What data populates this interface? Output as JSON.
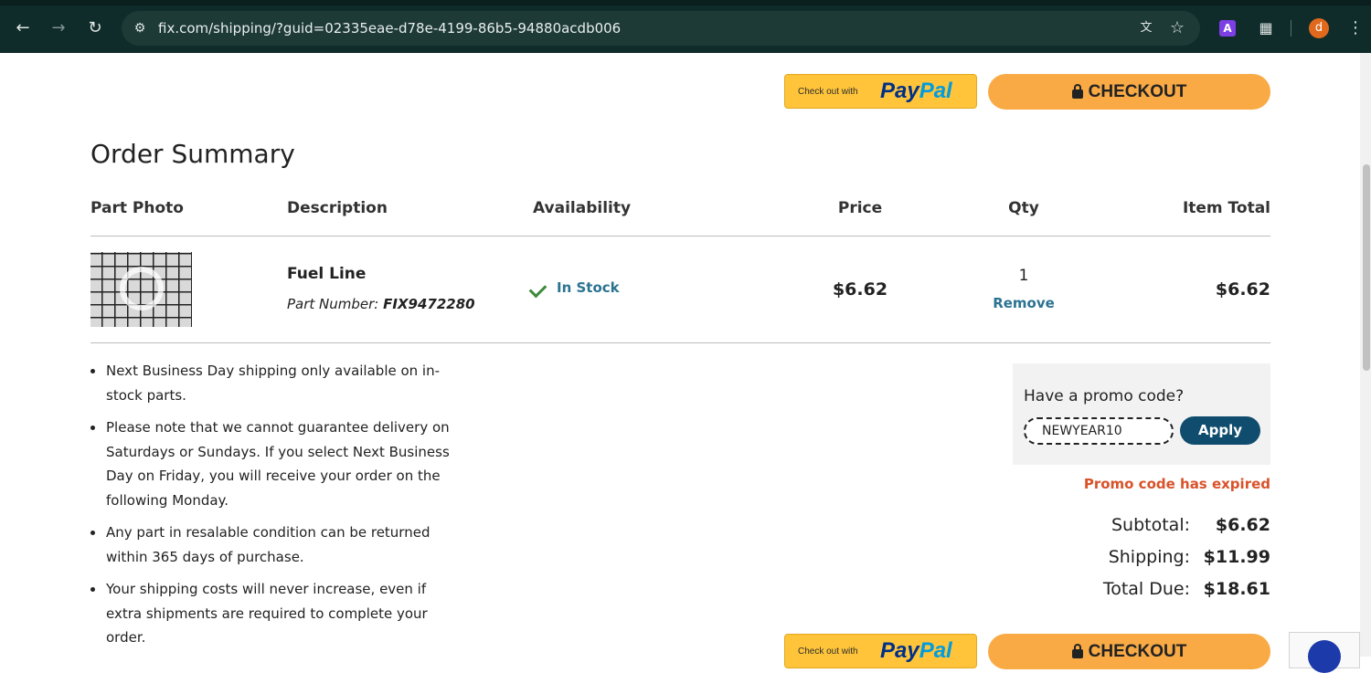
{
  "browser": {
    "url": "fix.com/shipping/?guid=02335eae-d78e-4199-86b5-94880acdb006",
    "extension_letter": "A",
    "avatar_letter": "d"
  },
  "actions": {
    "paypal_small": "Check out with",
    "paypal_pay": "Pay",
    "paypal_pal": "Pal",
    "checkout_label": "CHECKOUT"
  },
  "summary": {
    "title": "Order Summary",
    "headers": {
      "photo": "Part Photo",
      "description": "Description",
      "availability": "Availability",
      "price": "Price",
      "qty": "Qty",
      "item_total": "Item Total"
    },
    "item": {
      "name": "Fuel Line",
      "part_number_label": "Part Number:",
      "part_number": "FIX9472280",
      "availability": "In Stock",
      "price": "$6.62",
      "qty": "1",
      "remove_label": "Remove",
      "item_total": "$6.62"
    }
  },
  "notes": [
    "Next Business Day shipping only available on in-stock parts.",
    "Please note that we cannot guarantee delivery on Saturdays or Sundays. If you select Next Business Day on Friday, you will receive your order on the following Monday.",
    "Any part in resalable condition can be returned within 365 days of purchase.",
    "Your shipping costs will never increase, even if extra shipments are required to complete your order."
  ],
  "promo": {
    "question": "Have a promo code?",
    "code_value": "NEWYEAR10",
    "apply_label": "Apply",
    "error": "Promo code has expired"
  },
  "totals": {
    "subtotal_label": "Subtotal:",
    "subtotal": "$6.62",
    "shipping_label": "Shipping:",
    "shipping": "$11.99",
    "total_label": "Total Due:",
    "total": "$18.61"
  },
  "colors": {
    "checkout": "#f9aa45",
    "paypal": "#ffc439",
    "link": "#2b7390",
    "error": "#d9522a",
    "apply": "#0f4c6d"
  }
}
